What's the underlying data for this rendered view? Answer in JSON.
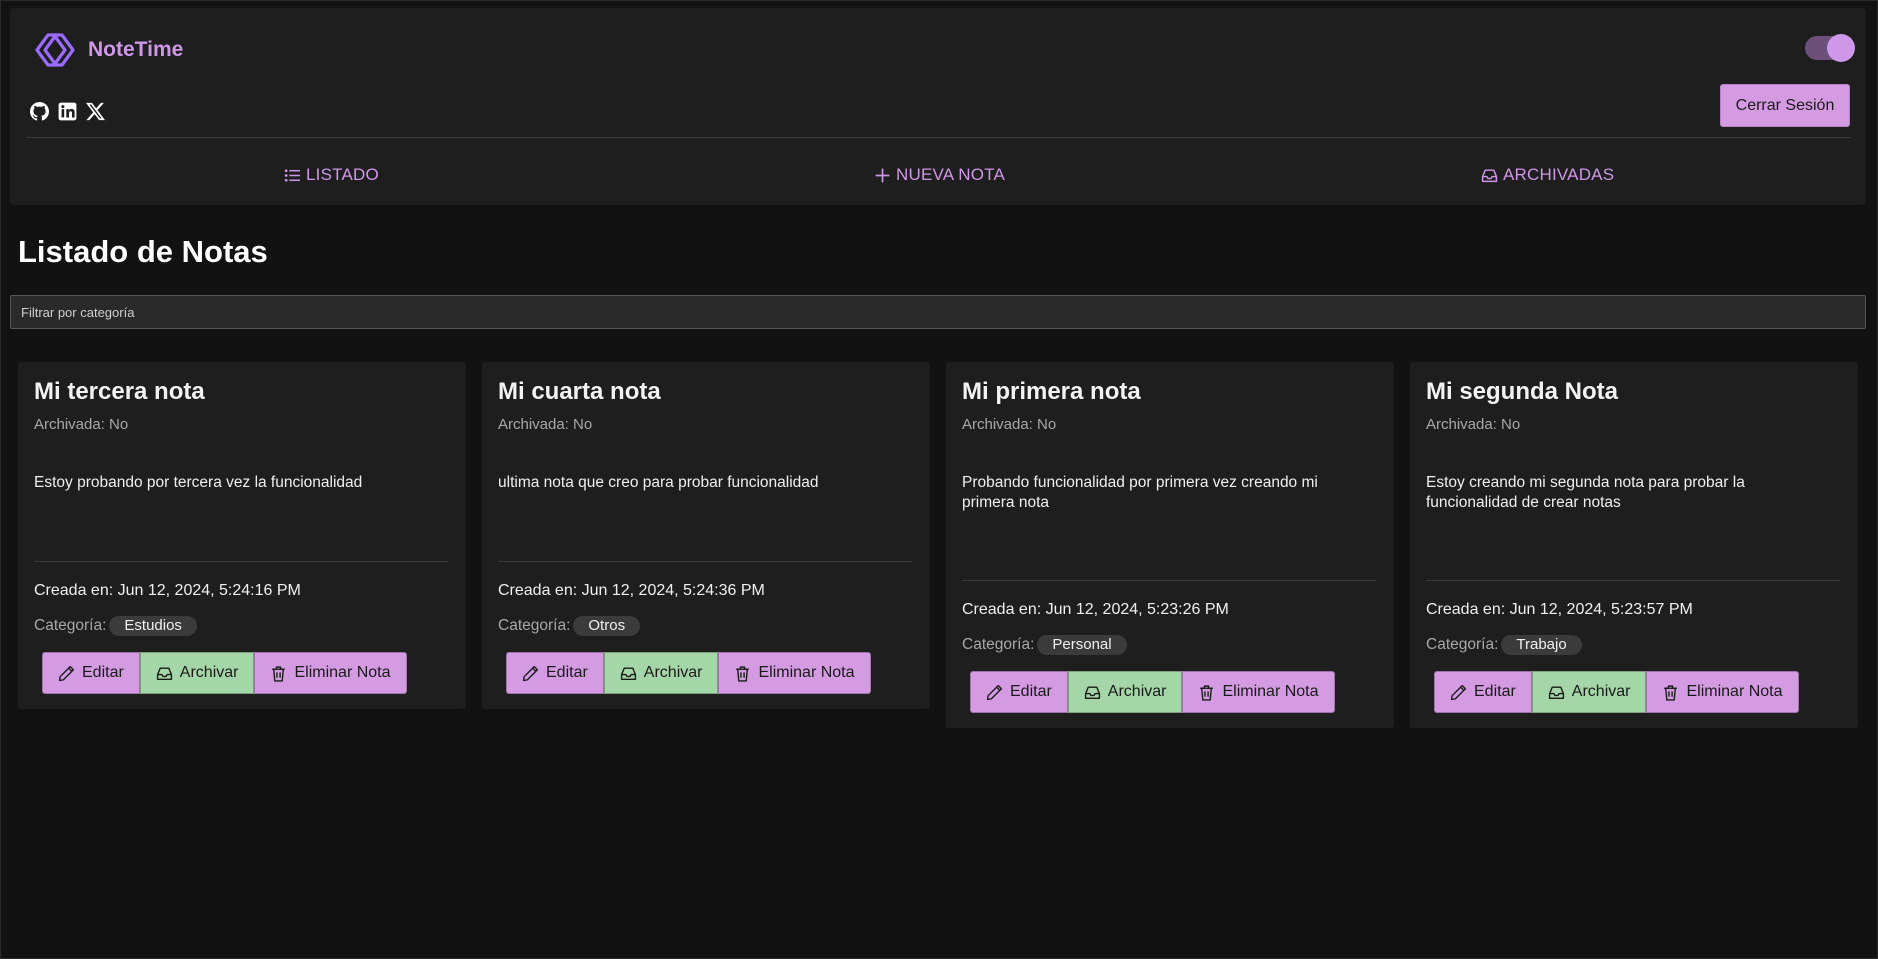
{
  "brand": {
    "name": "NoteTime"
  },
  "header": {
    "logout_label": "Cerrar Sesión"
  },
  "nav": [
    {
      "label": "LISTADO",
      "icon": "list-icon"
    },
    {
      "label": "NUEVA NOTA",
      "icon": "plus-icon"
    },
    {
      "label": "ARCHIVADAS",
      "icon": "inbox-icon"
    }
  ],
  "main": {
    "title": "Listado de Notas",
    "filter_placeholder": "Filtrar por categoría"
  },
  "labels": {
    "edit": "Editar",
    "archive": "Archivar",
    "delete": "Eliminar Nota",
    "category": "Categoría:"
  },
  "notes": [
    {
      "title": "Mi tercera nota",
      "archived": "Archivada: No",
      "content": "Estoy probando por tercera vez la funcionalidad",
      "created": "Creada en: Jun 12, 2024, 5:24:16 PM",
      "category": "Estudios"
    },
    {
      "title": "Mi cuarta nota",
      "archived": "Archivada: No",
      "content": "ultima nota que creo para probar funcionalidad",
      "created": "Creada en: Jun 12, 2024, 5:24:36 PM",
      "category": "Otros"
    },
    {
      "title": "Mi primera nota",
      "archived": "Archivada: No",
      "content": "Probando funcionalidad por primera vez creando mi primera nota",
      "created": "Creada en: Jun 12, 2024, 5:23:26 PM",
      "category": "Personal"
    },
    {
      "title": "Mi segunda Nota",
      "archived": "Archivada: No",
      "content": "Estoy creando mi segunda nota para probar la funcionalidad de crear notas",
      "created": "Creada en: Jun 12, 2024, 5:23:57 PM",
      "category": "Trabajo"
    }
  ],
  "colors": {
    "accent": "#cf97e8",
    "button_purple": "#d49be3",
    "button_green": "#a5d6a7",
    "background": "#121212",
    "surface": "#1e1e1e"
  },
  "theme_toggle": {
    "enabled": true
  }
}
